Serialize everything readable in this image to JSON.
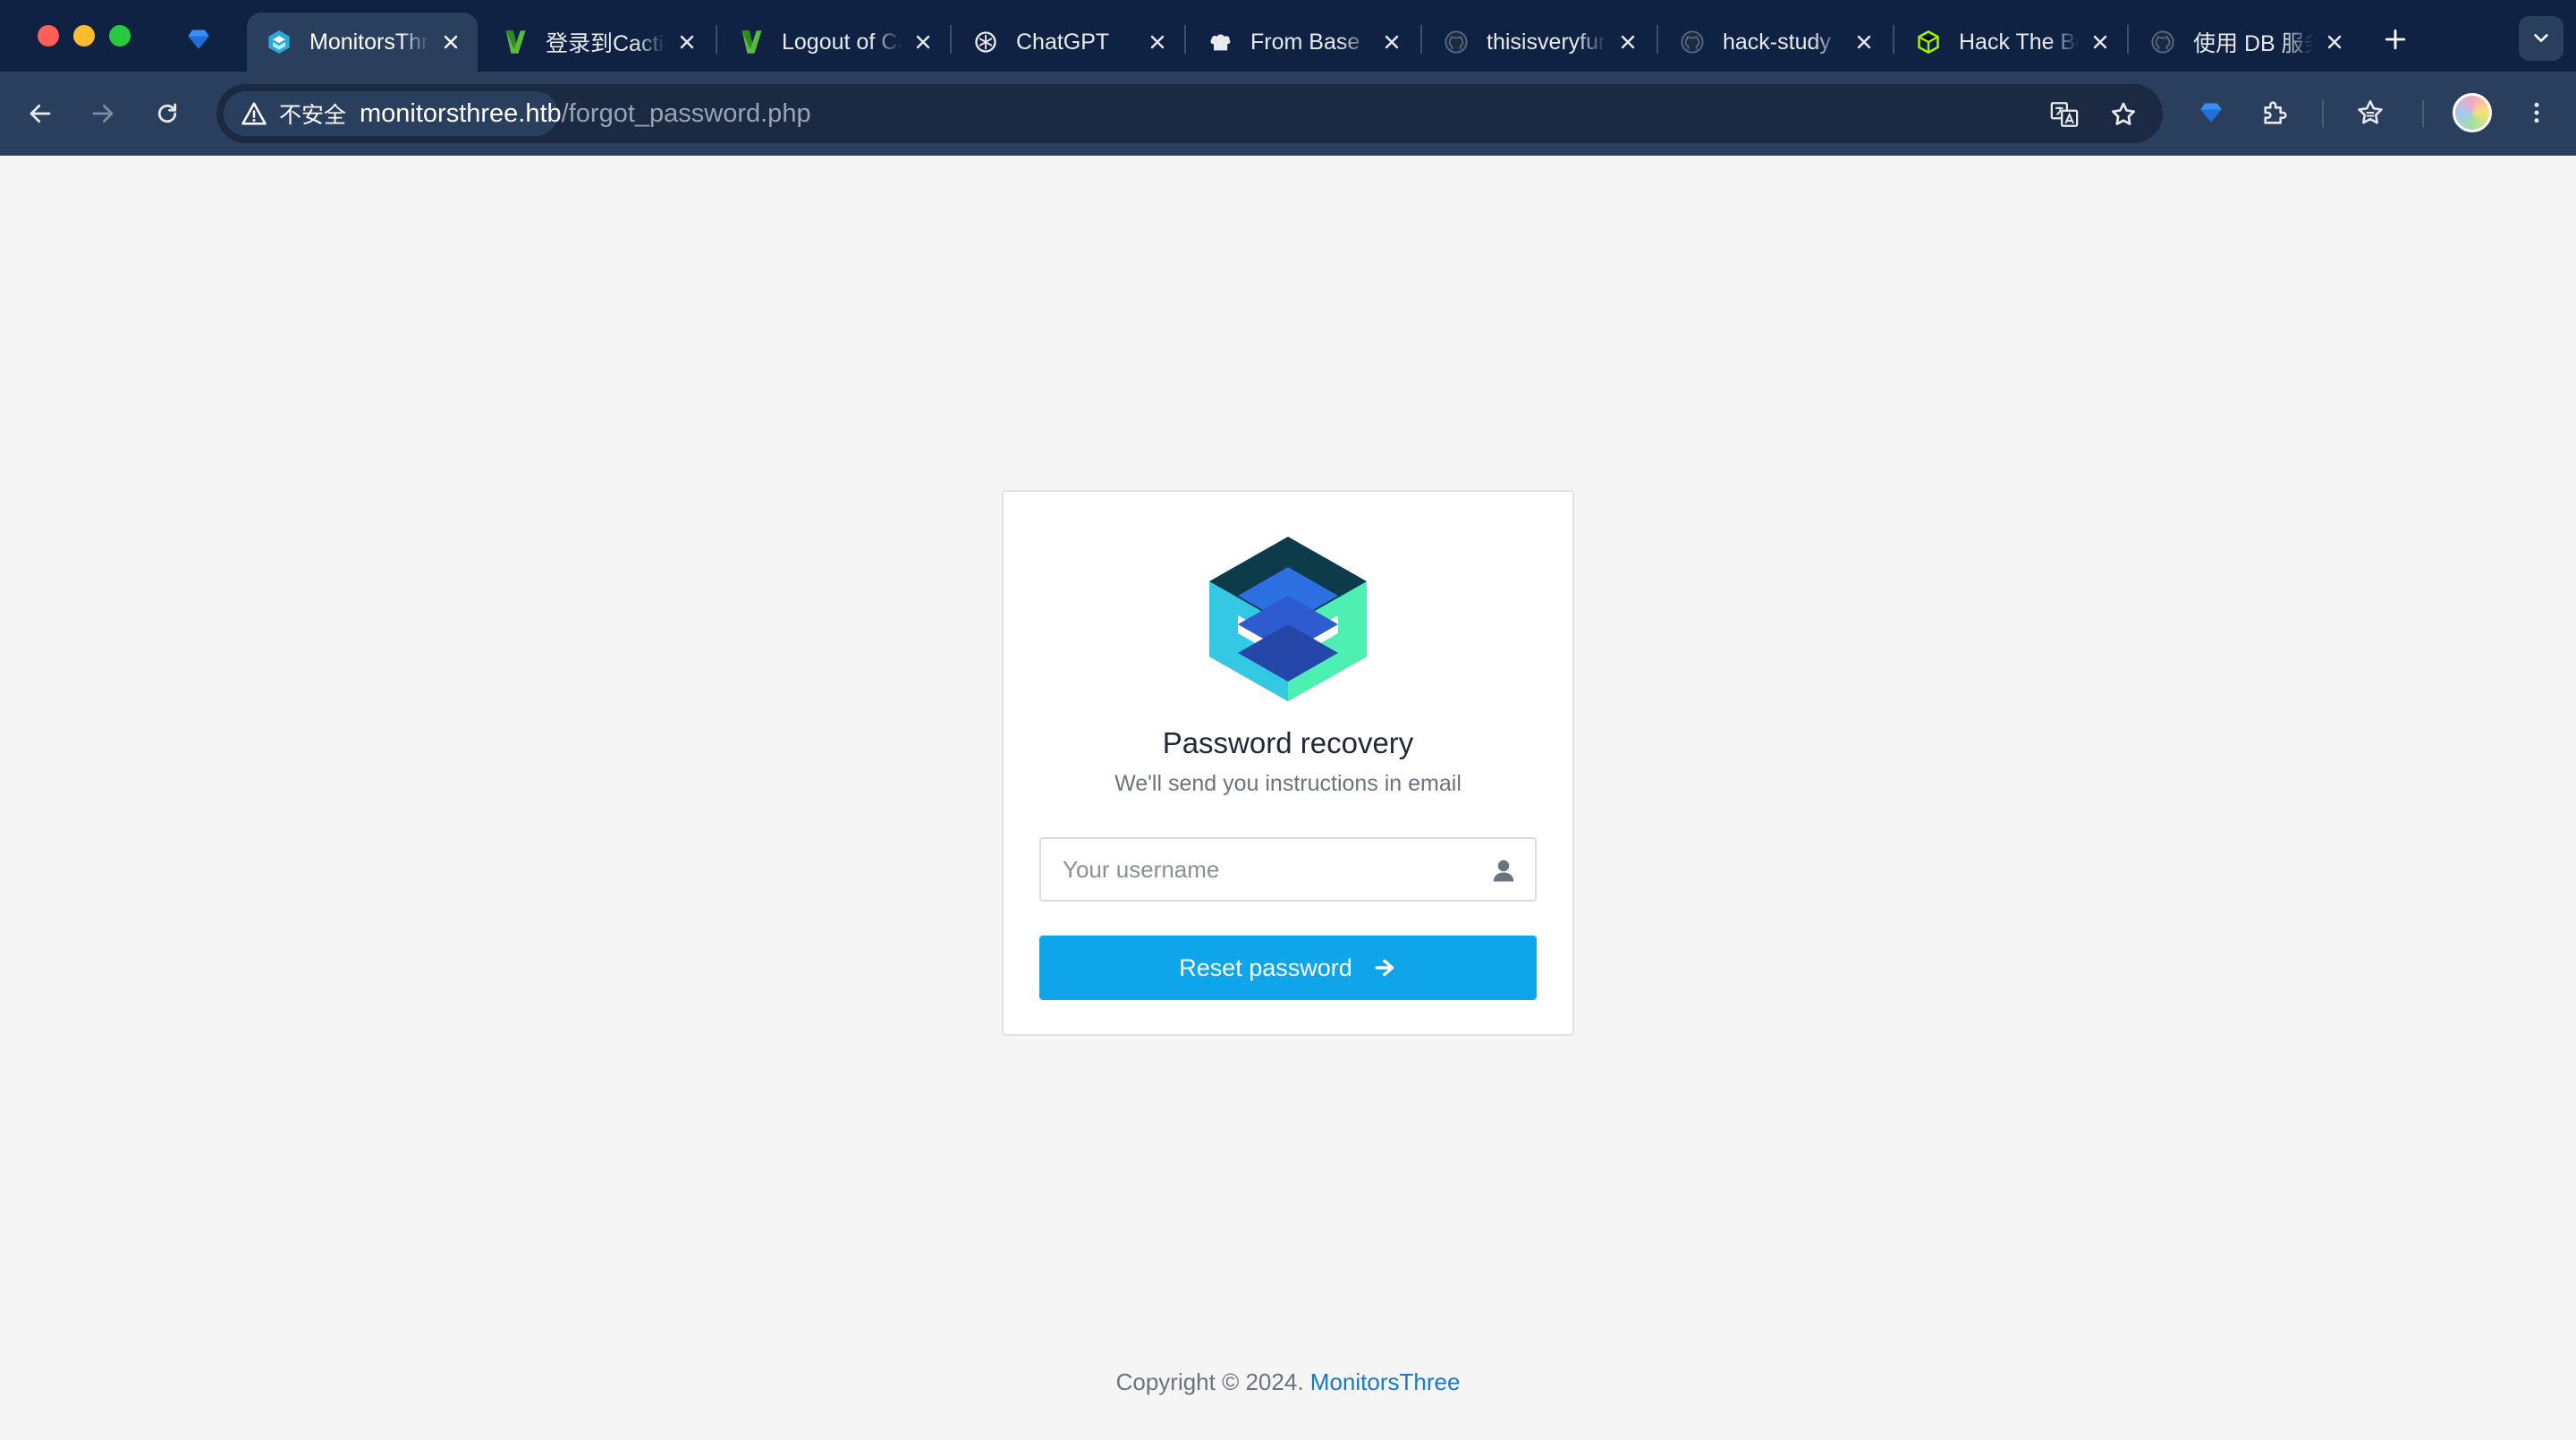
{
  "browser": {
    "tabs": [
      {
        "title": "MonitorsThree",
        "active": true,
        "favicon": "monitorsthree-icon"
      },
      {
        "title": "登录到Cacti",
        "active": false,
        "favicon": "cacti-icon"
      },
      {
        "title": "Logout of Cacti",
        "active": false,
        "favicon": "cacti-icon"
      },
      {
        "title": "ChatGPT",
        "active": false,
        "favicon": "chatgpt-icon"
      },
      {
        "title": "From Base",
        "active": false,
        "favicon": "chef-hat-icon"
      },
      {
        "title": "thisisveryfun",
        "active": false,
        "favicon": "github-icon"
      },
      {
        "title": "hack-study",
        "active": false,
        "favicon": "github-icon"
      },
      {
        "title": "Hack The Box",
        "active": false,
        "favicon": "hackthebox-icon"
      },
      {
        "title": "使用 DB 服务",
        "active": false,
        "favicon": "github-icon"
      }
    ],
    "security_label": "不安全",
    "url_host": "monitorsthree.htb",
    "url_path": "/forgot_password.php"
  },
  "recovery": {
    "title": "Password recovery",
    "subtitle": "We'll send you instructions in email",
    "username_placeholder": "Your username",
    "username_value": "",
    "reset_label": "Reset password"
  },
  "footer": {
    "copyright": "Copyright © 2024.",
    "brand": "MonitorsThree"
  },
  "colors": {
    "chrome_bg": "#0f2243",
    "toolbar_bg": "#2a3e5e",
    "page_bg": "#f5f5f5",
    "button_bg": "#0ea5ea",
    "link": "#1478d4"
  }
}
